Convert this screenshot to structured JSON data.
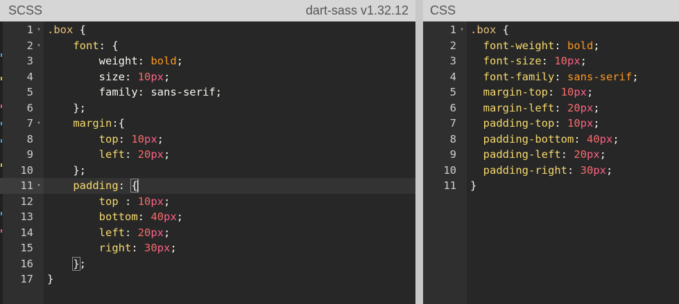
{
  "scss": {
    "title": "SCSS",
    "compiler": "dart-sass v1.32.12",
    "lines": [
      {
        "n": "1",
        "fold": true,
        "tokens": [
          {
            "t": ".box",
            "c": "sel"
          },
          {
            "t": " {",
            "c": "punct"
          }
        ]
      },
      {
        "n": "2",
        "fold": true,
        "tokens": [
          {
            "t": "    font",
            "c": "propkey"
          },
          {
            "t": ": {",
            "c": "punct"
          }
        ]
      },
      {
        "n": "3",
        "tokens": [
          {
            "t": "        weight",
            "c": "prop"
          },
          {
            "t": ": ",
            "c": "punct"
          },
          {
            "t": "bold",
            "c": "value"
          },
          {
            "t": ";",
            "c": "punct"
          }
        ]
      },
      {
        "n": "4",
        "tokens": [
          {
            "t": "        size",
            "c": "prop"
          },
          {
            "t": ": ",
            "c": "punct"
          },
          {
            "t": "10",
            "c": "num"
          },
          {
            "t": "px",
            "c": "unit"
          },
          {
            "t": ";",
            "c": "punct"
          }
        ]
      },
      {
        "n": "5",
        "tokens": [
          {
            "t": "        family",
            "c": "prop"
          },
          {
            "t": ": sans-serif;",
            "c": "punct"
          }
        ]
      },
      {
        "n": "6",
        "tokens": [
          {
            "t": "    };",
            "c": "punct"
          }
        ]
      },
      {
        "n": "7",
        "fold": true,
        "tokens": [
          {
            "t": "    margin",
            "c": "propkey"
          },
          {
            "t": ":{",
            "c": "punct"
          }
        ]
      },
      {
        "n": "8",
        "tokens": [
          {
            "t": "        top",
            "c": "propkey"
          },
          {
            "t": ": ",
            "c": "punct"
          },
          {
            "t": "10",
            "c": "num"
          },
          {
            "t": "px",
            "c": "unit"
          },
          {
            "t": ";",
            "c": "punct"
          }
        ]
      },
      {
        "n": "9",
        "tokens": [
          {
            "t": "        left",
            "c": "propkey"
          },
          {
            "t": ": ",
            "c": "punct"
          },
          {
            "t": "20",
            "c": "num"
          },
          {
            "t": "px",
            "c": "unit"
          },
          {
            "t": ";",
            "c": "punct"
          }
        ]
      },
      {
        "n": "10",
        "tokens": [
          {
            "t": "    };",
            "c": "punct"
          }
        ]
      },
      {
        "n": "11",
        "fold": true,
        "active": true,
        "tokens": [
          {
            "t": "    padding",
            "c": "propkey"
          },
          {
            "t": ": ",
            "c": "punct"
          },
          {
            "t": "{",
            "c": "punct",
            "hl": true
          },
          {
            "t": "",
            "c": "cursor"
          }
        ]
      },
      {
        "n": "12",
        "tokens": [
          {
            "t": "        top",
            "c": "propkey"
          },
          {
            "t": " : ",
            "c": "punct"
          },
          {
            "t": "10",
            "c": "num"
          },
          {
            "t": "px",
            "c": "unit"
          },
          {
            "t": ";",
            "c": "punct"
          }
        ]
      },
      {
        "n": "13",
        "tokens": [
          {
            "t": "        bottom",
            "c": "propkey"
          },
          {
            "t": ": ",
            "c": "punct"
          },
          {
            "t": "40",
            "c": "num"
          },
          {
            "t": "px",
            "c": "unit"
          },
          {
            "t": ";",
            "c": "punct"
          }
        ]
      },
      {
        "n": "14",
        "tokens": [
          {
            "t": "        left",
            "c": "propkey"
          },
          {
            "t": ": ",
            "c": "punct"
          },
          {
            "t": "20",
            "c": "num"
          },
          {
            "t": "px",
            "c": "unit"
          },
          {
            "t": ";",
            "c": "punct"
          }
        ]
      },
      {
        "n": "15",
        "tokens": [
          {
            "t": "        right",
            "c": "propkey"
          },
          {
            "t": ": ",
            "c": "punct"
          },
          {
            "t": "30",
            "c": "num"
          },
          {
            "t": "px",
            "c": "unit"
          },
          {
            "t": ";",
            "c": "punct"
          }
        ]
      },
      {
        "n": "16",
        "tokens": [
          {
            "t": "    ",
            "c": "punct"
          },
          {
            "t": "}",
            "c": "punct",
            "hl": true
          },
          {
            "t": ";",
            "c": "punct"
          }
        ]
      },
      {
        "n": "17",
        "tokens": [
          {
            "t": "}",
            "c": "punct"
          }
        ]
      }
    ]
  },
  "css": {
    "title": "CSS",
    "lines": [
      {
        "n": "1",
        "fold": true,
        "tokens": [
          {
            "t": ".box",
            "c": "sel"
          },
          {
            "t": " {",
            "c": "punct"
          }
        ]
      },
      {
        "n": "2",
        "tokens": [
          {
            "t": "  font-weight",
            "c": "propkey"
          },
          {
            "t": ": ",
            "c": "punct"
          },
          {
            "t": "bold",
            "c": "value"
          },
          {
            "t": ";",
            "c": "punct"
          }
        ]
      },
      {
        "n": "3",
        "tokens": [
          {
            "t": "  font-size",
            "c": "propkey"
          },
          {
            "t": ": ",
            "c": "punct"
          },
          {
            "t": "10",
            "c": "num"
          },
          {
            "t": "px",
            "c": "unit"
          },
          {
            "t": ";",
            "c": "punct"
          }
        ]
      },
      {
        "n": "4",
        "tokens": [
          {
            "t": "  font-family",
            "c": "propkey"
          },
          {
            "t": ": ",
            "c": "punct"
          },
          {
            "t": "sans-serif",
            "c": "value"
          },
          {
            "t": ";",
            "c": "punct"
          }
        ]
      },
      {
        "n": "5",
        "tokens": [
          {
            "t": "  margin-top",
            "c": "propkey"
          },
          {
            "t": ": ",
            "c": "punct"
          },
          {
            "t": "10",
            "c": "num"
          },
          {
            "t": "px",
            "c": "unit"
          },
          {
            "t": ";",
            "c": "punct"
          }
        ]
      },
      {
        "n": "6",
        "tokens": [
          {
            "t": "  margin-left",
            "c": "propkey"
          },
          {
            "t": ": ",
            "c": "punct"
          },
          {
            "t": "20",
            "c": "num"
          },
          {
            "t": "px",
            "c": "unit"
          },
          {
            "t": ";",
            "c": "punct"
          }
        ]
      },
      {
        "n": "7",
        "tokens": [
          {
            "t": "  padding-top",
            "c": "propkey"
          },
          {
            "t": ": ",
            "c": "punct"
          },
          {
            "t": "10",
            "c": "num"
          },
          {
            "t": "px",
            "c": "unit"
          },
          {
            "t": ";",
            "c": "punct"
          }
        ]
      },
      {
        "n": "8",
        "tokens": [
          {
            "t": "  padding-bottom",
            "c": "propkey"
          },
          {
            "t": ": ",
            "c": "punct"
          },
          {
            "t": "40",
            "c": "num"
          },
          {
            "t": "px",
            "c": "unit"
          },
          {
            "t": ";",
            "c": "punct"
          }
        ]
      },
      {
        "n": "9",
        "tokens": [
          {
            "t": "  padding-left",
            "c": "propkey"
          },
          {
            "t": ": ",
            "c": "punct"
          },
          {
            "t": "20",
            "c": "num"
          },
          {
            "t": "px",
            "c": "unit"
          },
          {
            "t": ";",
            "c": "punct"
          }
        ]
      },
      {
        "n": "10",
        "tokens": [
          {
            "t": "  padding-right",
            "c": "propkey"
          },
          {
            "t": ": ",
            "c": "punct"
          },
          {
            "t": "30",
            "c": "num"
          },
          {
            "t": "px",
            "c": "unit"
          },
          {
            "t": ";",
            "c": "punct"
          }
        ]
      },
      {
        "n": "11",
        "tokens": [
          {
            "t": "}",
            "c": "punct"
          }
        ]
      }
    ]
  },
  "colors": {
    "background": "#272727",
    "gutter": "#2f2f2f",
    "header": "#d6d6d6",
    "selector": "#e6c07b",
    "property": "#f6d96d",
    "keyword_value": "#fd971f",
    "number": "#f96b6b",
    "unit": "#ff6188"
  }
}
